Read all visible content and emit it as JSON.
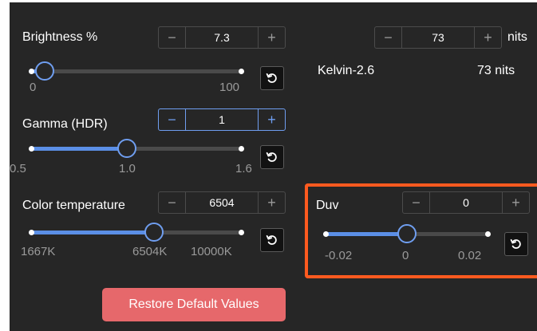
{
  "brightness": {
    "label": "Brightness %",
    "value": "7.3",
    "range_min_label": "0",
    "range_max_label": "100",
    "level": 0.073
  },
  "nits": {
    "value": "73",
    "unit": "nits",
    "kelvin_text": "Kelvin-2.6",
    "nits_text": "73 nits"
  },
  "gamma": {
    "label": "Gamma (HDR)",
    "value": "1",
    "ticks": [
      "0.5",
      "1.0",
      "1.6"
    ],
    "level": 0.4545
  },
  "color_temperature": {
    "label": "Color temperature",
    "value": "6504",
    "ticks": [
      "1667K",
      "6504K",
      "10000K"
    ],
    "level": 0.5805
  },
  "duv": {
    "label": "Duv",
    "value": "0",
    "ticks": [
      "-0.02",
      "0",
      "0.02"
    ],
    "level": 0.5
  },
  "stepper": {
    "minus": "−",
    "plus": "+"
  },
  "restore_button": "Restore Default Values",
  "colors": {
    "panel": "#262626",
    "accent": "#5b8fe6",
    "restore": "#e6686b",
    "highlight": "#ff5a1f"
  }
}
